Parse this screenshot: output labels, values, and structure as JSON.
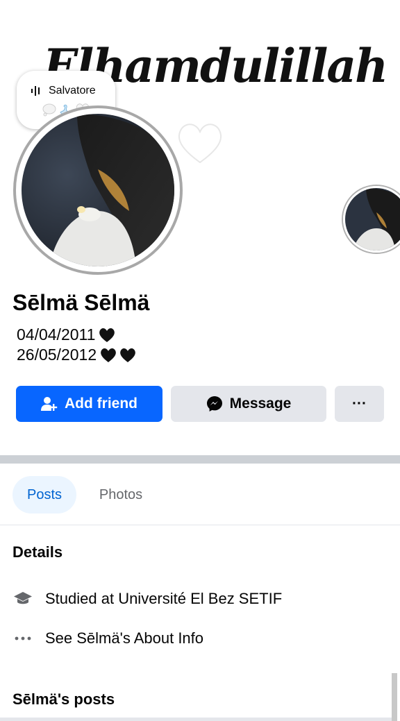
{
  "cover": {
    "script_text": "Elhamdulillah"
  },
  "note": {
    "song_label": "Salvatore",
    "music_icon": "audio-bars-icon",
    "emoji": [
      "thought-bubble-icon",
      "swan-icon",
      "white-heart-icon"
    ]
  },
  "profile": {
    "name": "Sēlmä Sēlmä",
    "bio_line1": "04/04/2011",
    "bio_line1_hearts": 1,
    "bio_line2": "26/05/2012",
    "bio_line2_hearts": 2
  },
  "actions": {
    "add_friend": "Add friend",
    "message": "Message",
    "more": "···"
  },
  "tabs": [
    {
      "label": "Posts",
      "active": true
    },
    {
      "label": "Photos",
      "active": false
    }
  ],
  "details": {
    "title": "Details",
    "education": "Studied at Université El Bez SETIF",
    "about": "See Sēlmä's About Info"
  },
  "posts_section": {
    "title": "Sēlmä's posts"
  },
  "colors": {
    "primary_blue": "#0866ff",
    "secondary_gray": "#e4e6eb",
    "tab_active_bg": "#ebf5ff",
    "tab_active_text": "#0064d1",
    "muted_text": "#65676b",
    "divider": "#ccd0d5"
  }
}
